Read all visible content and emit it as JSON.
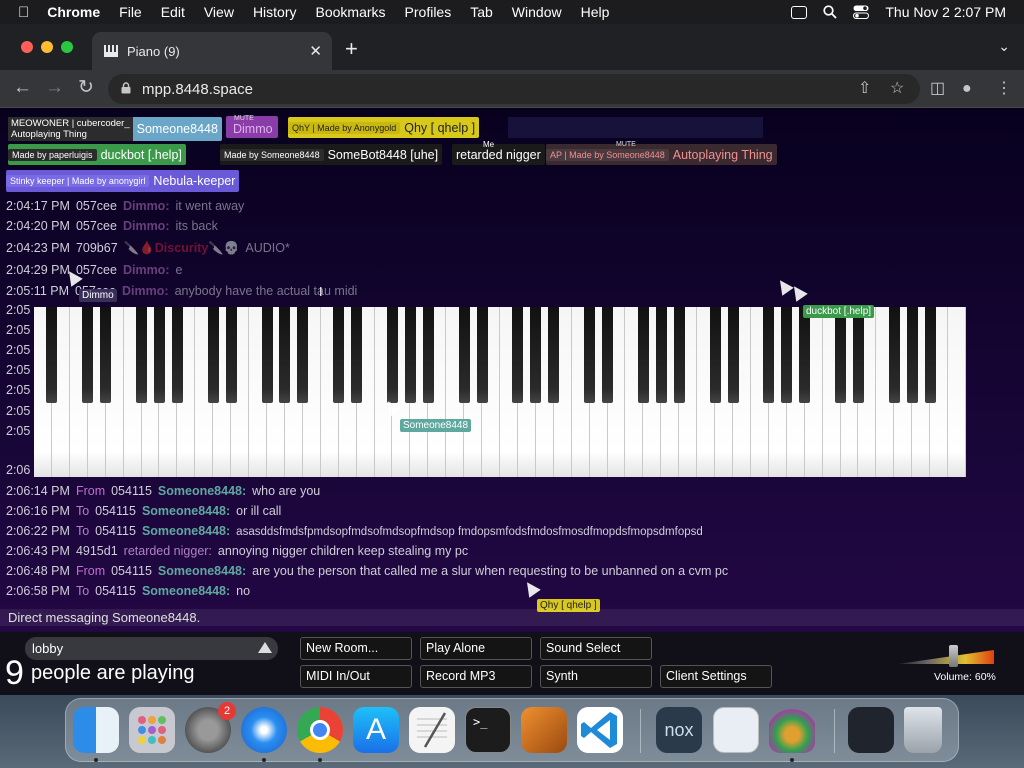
{
  "menubar": {
    "app": "Chrome",
    "items": [
      "File",
      "Edit",
      "View",
      "History",
      "Bookmarks",
      "Profiles",
      "Tab",
      "Window",
      "Help"
    ],
    "datetime": "Thu Nov 2  2:07 PM"
  },
  "browser": {
    "tab_title": "Piano (9)",
    "url": "mpp.8448.space"
  },
  "participants": [
    {
      "sub": "MEOWONER | cubercoder_",
      "sub2": "Autoplaying Thing",
      "name": "Someone8448",
      "bg": "#6aa6c8",
      "subbg": "#2c2c2c"
    },
    {
      "tag": "MUTE",
      "name": "Dimmo",
      "bg": "#8a3ca8"
    },
    {
      "sub": "QhY | Made by Anonygold",
      "name": "Qhy [ qhelp ]",
      "bg": "#d8c81a",
      "color": "#222"
    },
    {
      "sub": "Made by paperluigis",
      "name": "duckbot [.help]",
      "bg": "#3a9a4a"
    },
    {
      "sub": "Made by Someone8448",
      "name": "SomeBot8448 [uhe]",
      "bg": "#1a1a1a"
    },
    {
      "tag": "Me",
      "name": "retarded nigger",
      "bg": "#1a1a1a"
    },
    {
      "tag": "MUTE",
      "sub": "AP | Made by Someone8448",
      "name": "Autoplaying Thing",
      "bg": "#3a2a30",
      "color": "#f09090"
    },
    {
      "sub": "Stinky keeper | Made by anonygirl",
      "name": "Nebula-keeper",
      "bg": "#6a5ad8"
    }
  ],
  "chat_top": [
    {
      "time": "2:04:17 PM",
      "id": "057cee",
      "name": "Dimmo:",
      "msg": "it went away"
    },
    {
      "time": "2:04:20 PM",
      "id": "057cee",
      "name": "Dimmo:",
      "msg": "its back"
    },
    {
      "time": "2:04:23 PM",
      "id": "709b67",
      "name": "🔪🩸Discurity🔪💀",
      "msg": "AUDIO*"
    },
    {
      "time": "2:04:29 PM",
      "id": "057cee",
      "name": "Dimmo:",
      "msg": "e"
    },
    {
      "time": "2:05:11 PM",
      "id": "057cee",
      "name": "Dimmo:",
      "msg": "anybody have the actual tau midi"
    }
  ],
  "clipped_times": [
    "2:05",
    "2:05",
    "2:05",
    "2:05",
    "2:05",
    "2:05",
    "2:05",
    "2:06"
  ],
  "chat_bottom": [
    {
      "time": "2:06:14 PM",
      "dir": "From",
      "id": "054115",
      "name": "Someone8448:",
      "msg": "who are you"
    },
    {
      "time": "2:06:16 PM",
      "dir": "To",
      "id": "054115",
      "name": "Someone8448:",
      "msg": "or ill call"
    },
    {
      "time": "2:06:22 PM",
      "dir": "To",
      "id": "054115",
      "name": "Someone8448:",
      "msg": "asasddsfmdsfpmdsopfmdsofmdsopfmdsop fmdopsmfodsfmdosfmosdfmopdsfmopsdmfopsd"
    },
    {
      "time": "2:06:43 PM",
      "dir": "",
      "id": "4915d1",
      "name": "retarded nigger:",
      "msg": "annoying nigger children keep stealing my pc"
    },
    {
      "time": "2:06:48 PM",
      "dir": "From",
      "id": "054115",
      "name": "Someone8448:",
      "msg": "are you the person that called me a slur when requesting to be unbanned on a cvm pc"
    },
    {
      "time": "2:06:58 PM",
      "dir": "To",
      "id": "054115",
      "name": "Someone8448:",
      "msg": "no"
    }
  ],
  "cursors": {
    "dimmo": "Dimmo",
    "someone": "Someone8448",
    "duckbot": "duckbot [.help]",
    "qhy": "Qhy [ qhelp ]"
  },
  "status": "Direct messaging Someone8448.",
  "controls": {
    "room": "lobby",
    "count": "9",
    "count_label": "people are playing",
    "buttons": {
      "new_room": "New Room...",
      "play_alone": "Play Alone",
      "sound_select": "Sound Select",
      "midi": "MIDI In/Out",
      "record": "Record MP3",
      "synth": "Synth",
      "client_settings": "Client Settings"
    },
    "volume_label": "Volume: 60%",
    "volume": 0.6
  },
  "dock": {
    "apps": [
      "finder-icon",
      "launchpad-icon",
      "system-settings-icon",
      "safari-icon",
      "chrome-icon",
      "app-store-icon",
      "textedit-icon",
      "terminal-icon",
      "garageband-icon",
      "vscode-icon",
      "nox-icon",
      "preview-icon",
      "simulator-icon",
      "desktop-folder-icon",
      "trash-icon"
    ],
    "settings_badge": "2",
    "nox_label": "nox"
  }
}
